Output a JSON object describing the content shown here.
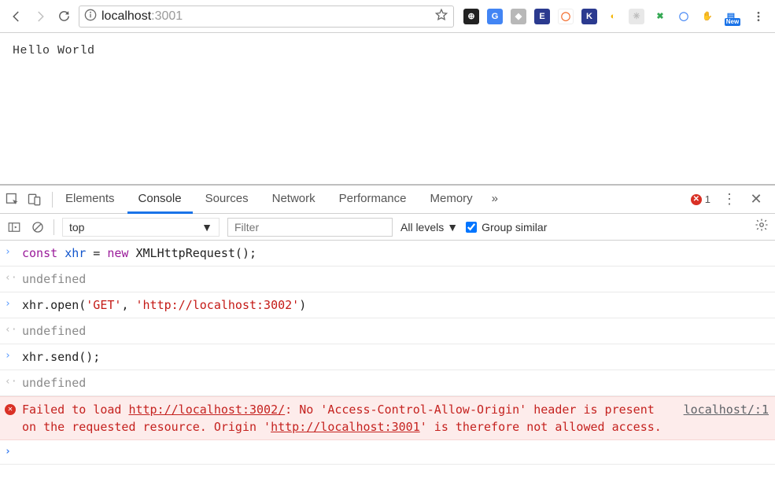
{
  "browser": {
    "url_host": "localhost",
    "url_port": ":3001",
    "new_badge": "New"
  },
  "page": {
    "body_text": "Hello World"
  },
  "devtools": {
    "tabs": [
      "Elements",
      "Console",
      "Sources",
      "Network",
      "Performance",
      "Memory"
    ],
    "active_tab": "Console",
    "overflow_glyph": "»",
    "error_count": "1",
    "toolbar": {
      "context": "top",
      "filter_placeholder": "Filter",
      "levels_label": "All levels",
      "group_label": "Group similar",
      "group_checked": true
    },
    "console": {
      "entries": [
        {
          "kind": "input",
          "tokens": [
            {
              "t": "kw",
              "v": "const "
            },
            {
              "t": "var",
              "v": "xhr"
            },
            {
              "t": "plain",
              "v": " = "
            },
            {
              "t": "kw",
              "v": "new"
            },
            {
              "t": "plain",
              "v": " XMLHttpRequest();"
            }
          ]
        },
        {
          "kind": "output",
          "text": "undefined"
        },
        {
          "kind": "input",
          "tokens": [
            {
              "t": "plain",
              "v": "xhr.open("
            },
            {
              "t": "str",
              "v": "'GET'"
            },
            {
              "t": "plain",
              "v": ", "
            },
            {
              "t": "str",
              "v": "'http://localhost:3002'"
            },
            {
              "t": "plain",
              "v": ")"
            }
          ]
        },
        {
          "kind": "output",
          "text": "undefined"
        },
        {
          "kind": "input",
          "tokens": [
            {
              "t": "plain",
              "v": "xhr.send();"
            }
          ]
        },
        {
          "kind": "output",
          "text": "undefined"
        },
        {
          "kind": "error",
          "source": "localhost/:1",
          "pre": "Failed to load ",
          "url1": "http://localhost:3002/",
          "mid1": ": No '",
          "hdr": "Access-Control-Allow-Origin",
          "mid2": "' header is present on the requested resource. Origin '",
          "url2": "http://localhost:3001",
          "post": "' is therefore not allowed access."
        }
      ]
    }
  }
}
